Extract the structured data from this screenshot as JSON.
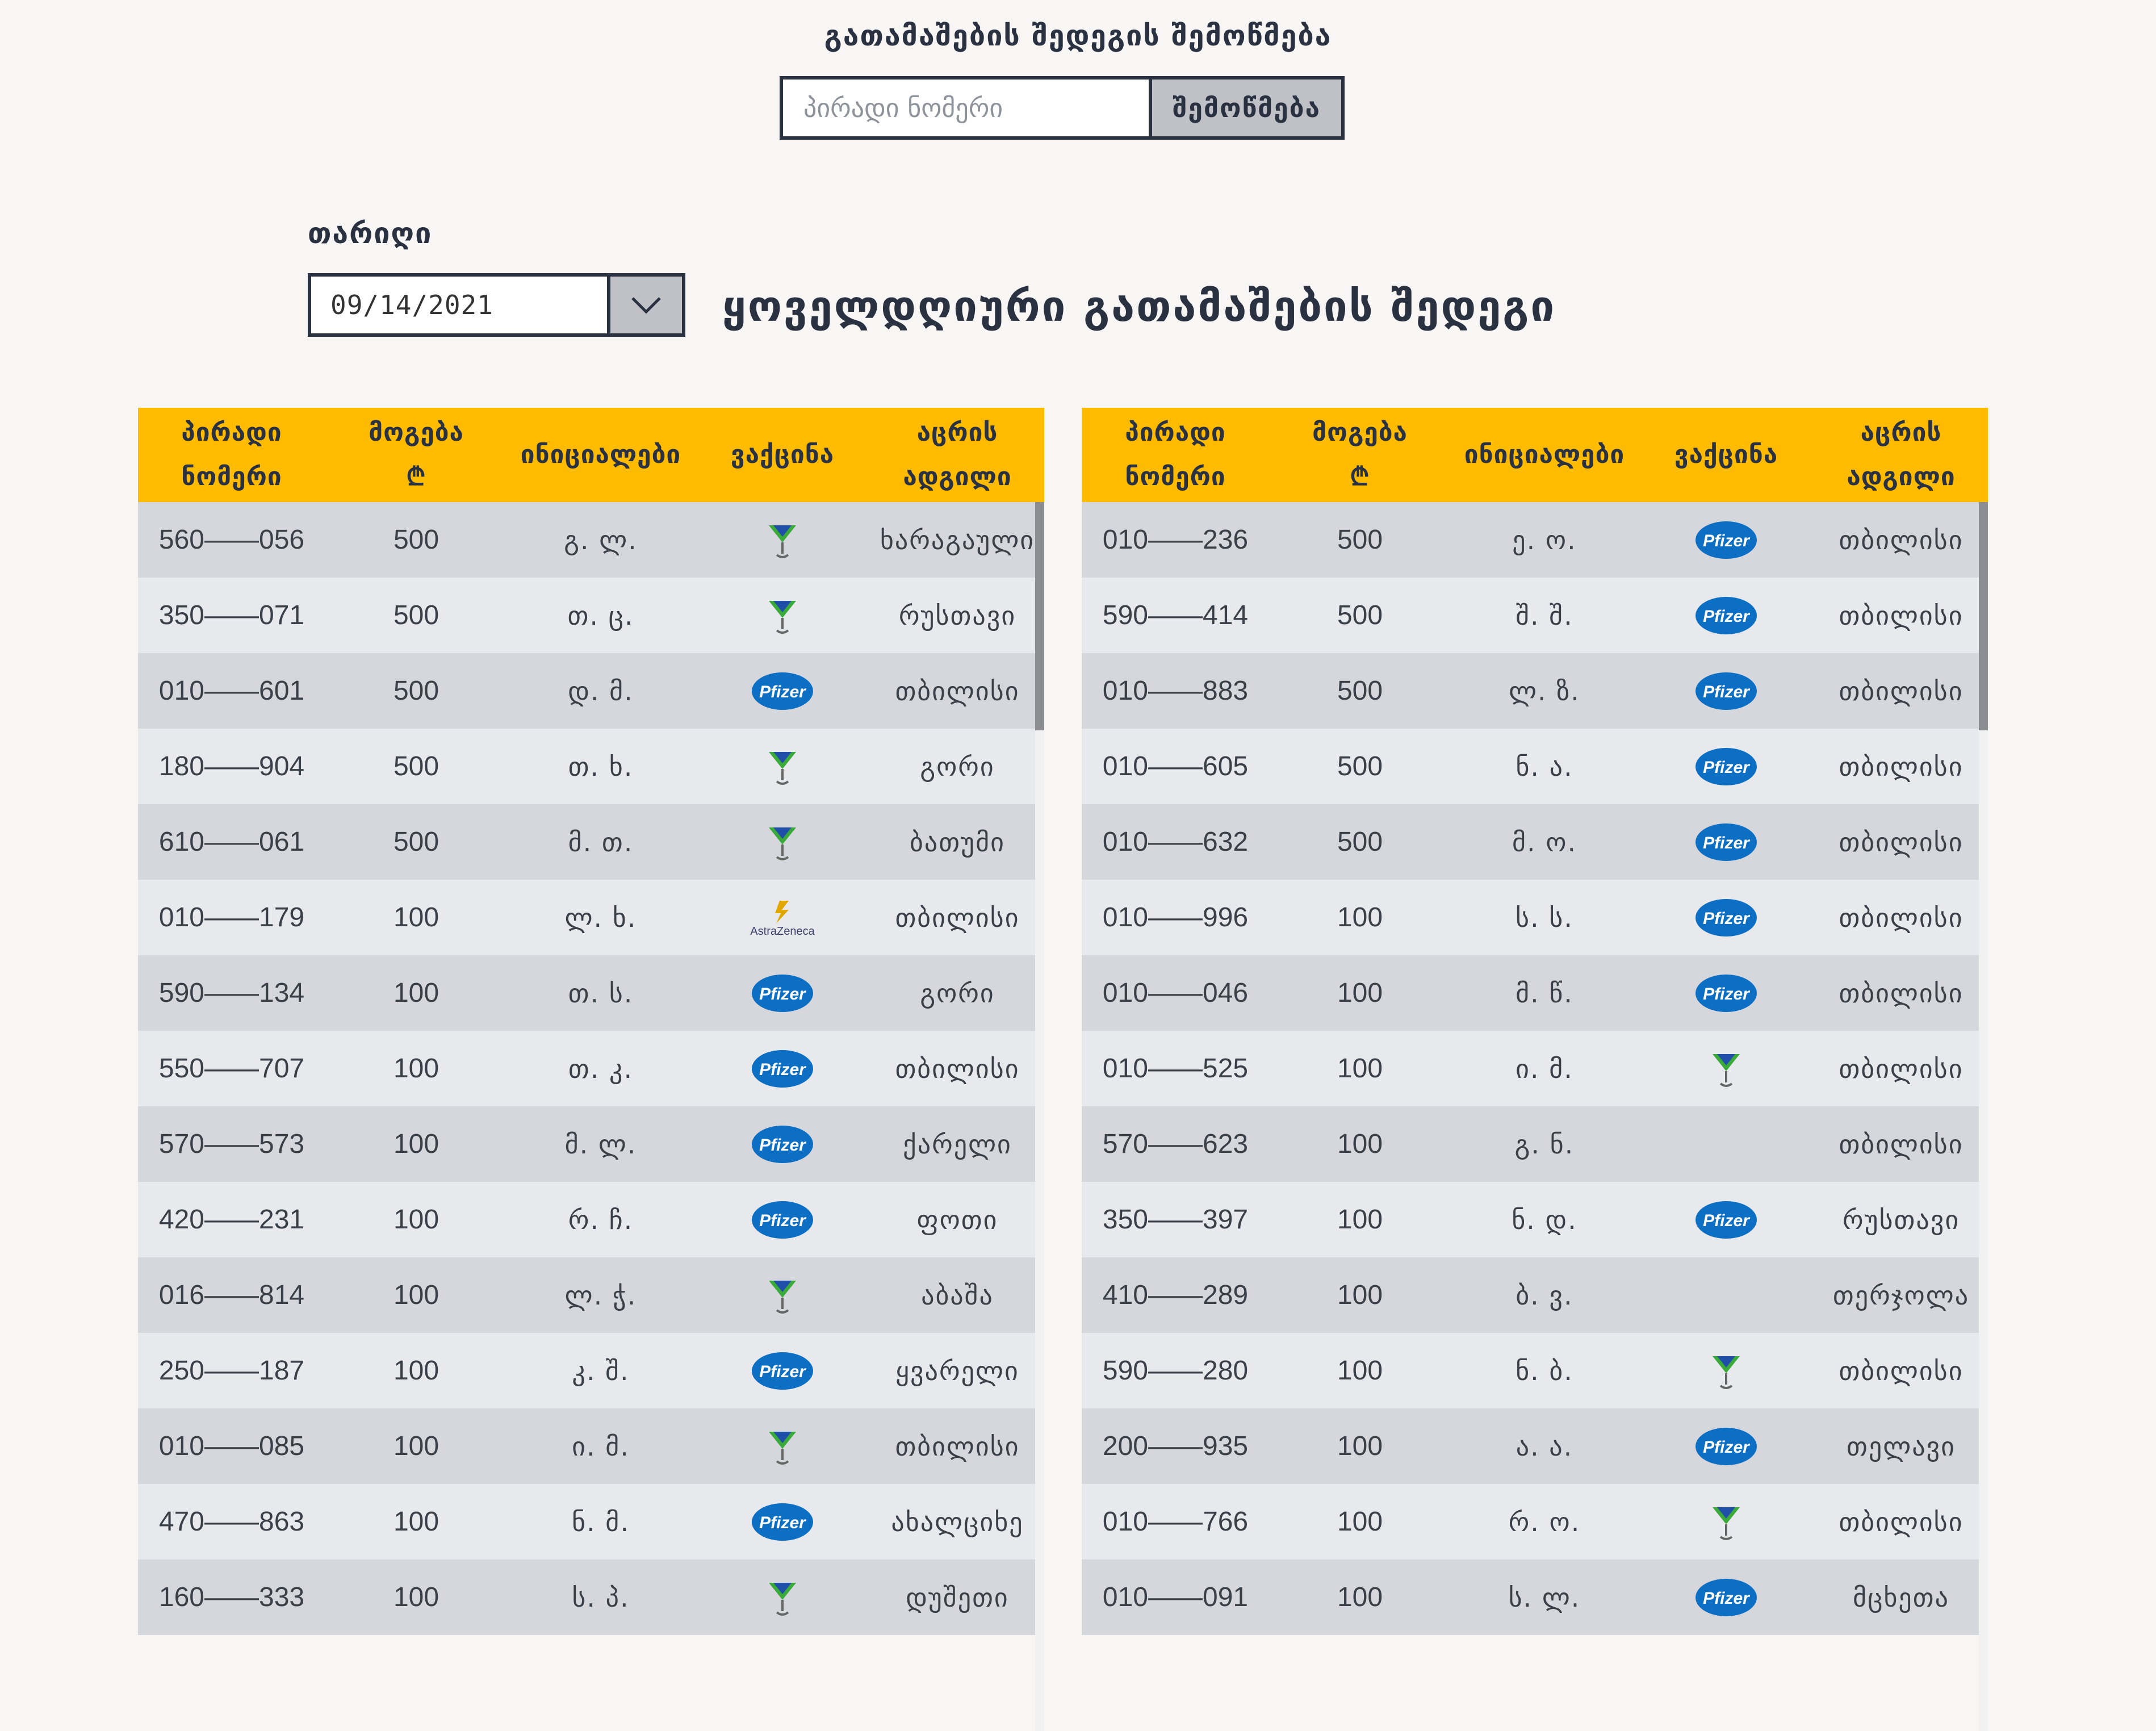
{
  "check": {
    "title": "გათამაშების შედეგის შემოწმება",
    "placeholder": "პირადი ნომერი",
    "button": "შემოწმება"
  },
  "date": {
    "label": "თარიღი",
    "value": "09/14/2021"
  },
  "daily_title": "ყოველდღიური გათამაშების შედეგი",
  "columns": {
    "id_line1": "პირადი",
    "id_line2": "ნომერი",
    "prize_line1": "მოგება",
    "prize_line2": "₾",
    "initials": "ინიციალები",
    "vaccine": "ვაქცინა",
    "place_line1": "აცრის",
    "place_line2": "ადგილი"
  },
  "vaccine_labels": {
    "pfizer": "Pfizer",
    "astrazeneca": "AstraZeneca"
  },
  "colors": {
    "header_bg": "#ffbb00",
    "row_odd": "#d5d7dc",
    "row_even": "#e7e9ed",
    "pfizer_blue": "#0d6fc4",
    "sinopharm_green": "#3aaa3a",
    "astrazeneca_gold": "#e0a800"
  },
  "left_table": [
    {
      "id": "560——056",
      "prize": "500",
      "initials": "გ. ლ.",
      "vaccine": "sinopharm",
      "place": "ხარაგაული"
    },
    {
      "id": "350——071",
      "prize": "500",
      "initials": "თ. ც.",
      "vaccine": "sinopharm",
      "place": "რუსთავი"
    },
    {
      "id": "010——601",
      "prize": "500",
      "initials": "დ. მ.",
      "vaccine": "pfizer",
      "place": "თბილისი"
    },
    {
      "id": "180——904",
      "prize": "500",
      "initials": "თ. ხ.",
      "vaccine": "sinopharm",
      "place": "გორი"
    },
    {
      "id": "610——061",
      "prize": "500",
      "initials": "მ. თ.",
      "vaccine": "sinopharm",
      "place": "ბათუმი"
    },
    {
      "id": "010——179",
      "prize": "100",
      "initials": "ლ. ხ.",
      "vaccine": "astrazeneca",
      "place": "თბილისი"
    },
    {
      "id": "590——134",
      "prize": "100",
      "initials": "თ. ს.",
      "vaccine": "pfizer",
      "place": "გორი"
    },
    {
      "id": "550——707",
      "prize": "100",
      "initials": "თ. კ.",
      "vaccine": "pfizer",
      "place": "თბილისი"
    },
    {
      "id": "570——573",
      "prize": "100",
      "initials": "მ. ლ.",
      "vaccine": "pfizer",
      "place": "ქარელი"
    },
    {
      "id": "420——231",
      "prize": "100",
      "initials": "რ. ჩ.",
      "vaccine": "pfizer",
      "place": "ფოთი"
    },
    {
      "id": "016——814",
      "prize": "100",
      "initials": "ლ. ჭ.",
      "vaccine": "sinopharm",
      "place": "აბაშა"
    },
    {
      "id": "250——187",
      "prize": "100",
      "initials": "კ. შ.",
      "vaccine": "pfizer",
      "place": "ყვარელი"
    },
    {
      "id": "010——085",
      "prize": "100",
      "initials": "ი. მ.",
      "vaccine": "sinopharm",
      "place": "თბილისი"
    },
    {
      "id": "470——863",
      "prize": "100",
      "initials": "ნ. მ.",
      "vaccine": "pfizer",
      "place": "ახალციხე"
    },
    {
      "id": "160——333",
      "prize": "100",
      "initials": "ს. პ.",
      "vaccine": "sinopharm",
      "place": "დუშეთი"
    }
  ],
  "right_table": [
    {
      "id": "010——236",
      "prize": "500",
      "initials": "ე. ო.",
      "vaccine": "pfizer",
      "place": "თბილისი"
    },
    {
      "id": "590——414",
      "prize": "500",
      "initials": "შ. შ.",
      "vaccine": "pfizer",
      "place": "თბილისი"
    },
    {
      "id": "010——883",
      "prize": "500",
      "initials": "ლ. ზ.",
      "vaccine": "pfizer",
      "place": "თბილისი"
    },
    {
      "id": "010——605",
      "prize": "500",
      "initials": "ნ. ა.",
      "vaccine": "pfizer",
      "place": "თბილისი"
    },
    {
      "id": "010——632",
      "prize": "500",
      "initials": "მ. ო.",
      "vaccine": "pfizer",
      "place": "თბილისი"
    },
    {
      "id": "010——996",
      "prize": "100",
      "initials": "ს. ს.",
      "vaccine": "pfizer",
      "place": "თბილისი"
    },
    {
      "id": "010——046",
      "prize": "100",
      "initials": "მ. წ.",
      "vaccine": "pfizer",
      "place": "თბილისი"
    },
    {
      "id": "010——525",
      "prize": "100",
      "initials": "ი. მ.",
      "vaccine": "sinopharm",
      "place": "თბილისი"
    },
    {
      "id": "570——623",
      "prize": "100",
      "initials": "გ. ნ.",
      "vaccine": "",
      "place": "თბილისი"
    },
    {
      "id": "350——397",
      "prize": "100",
      "initials": "ნ. დ.",
      "vaccine": "pfizer",
      "place": "რუსთავი"
    },
    {
      "id": "410——289",
      "prize": "100",
      "initials": "ბ. ვ.",
      "vaccine": "",
      "place": "თერჯოლა"
    },
    {
      "id": "590——280",
      "prize": "100",
      "initials": "ნ. ბ.",
      "vaccine": "sinopharm",
      "place": "თბილისი"
    },
    {
      "id": "200——935",
      "prize": "100",
      "initials": "ა. ა.",
      "vaccine": "pfizer",
      "place": "თელავი"
    },
    {
      "id": "010——766",
      "prize": "100",
      "initials": "რ. ო.",
      "vaccine": "sinopharm",
      "place": "თბილისი"
    },
    {
      "id": "010——091",
      "prize": "100",
      "initials": "ს. ლ.",
      "vaccine": "pfizer",
      "place": "მცხეთა"
    }
  ]
}
